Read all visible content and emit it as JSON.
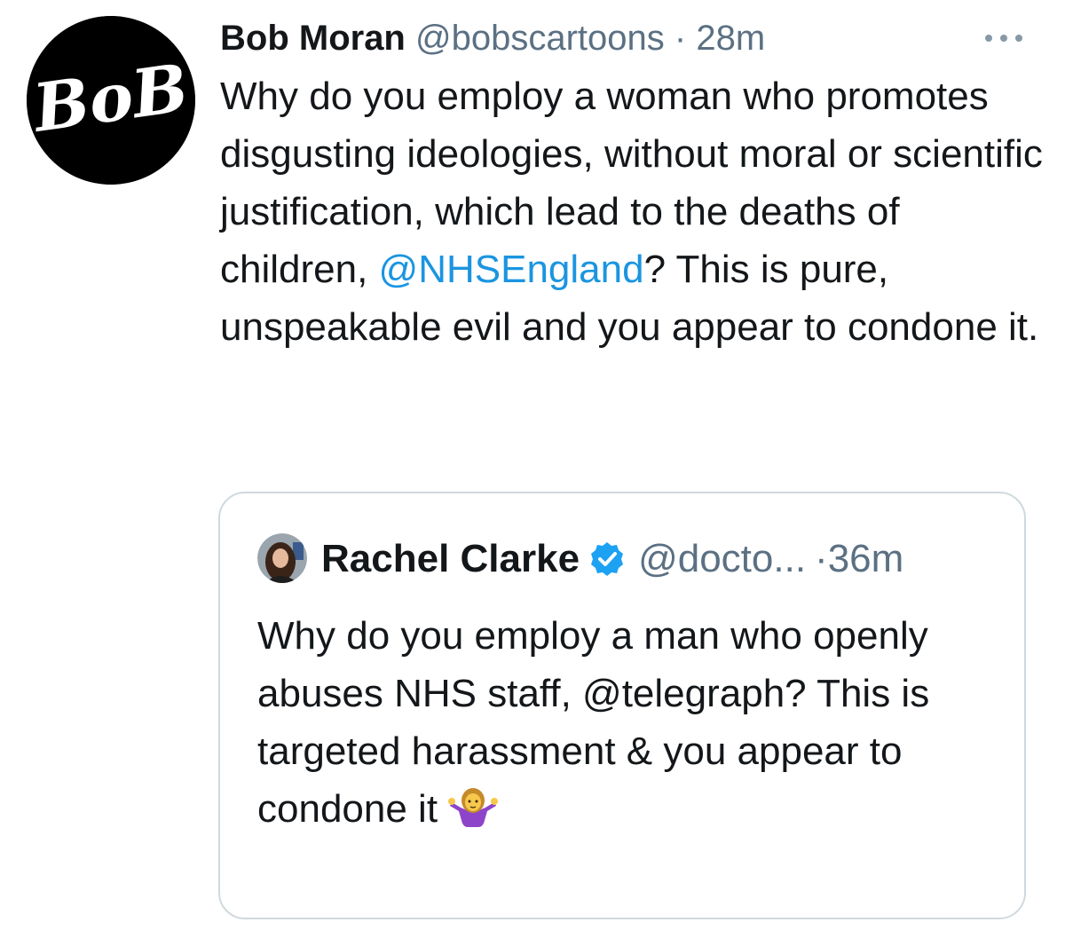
{
  "tweet": {
    "author": {
      "name": "Bob Moran",
      "handle": "@bobscartoons",
      "avatar_text": "BoB"
    },
    "separator": "·",
    "time": "28m",
    "text": {
      "part1": "Why do you employ a woman who promotes disgusting ideologies, without moral or scientific justification, which lead to the deaths of children, ",
      "mention": "@NHSEngland",
      "part2": "? This is pure, unspeakable evil and you appear to condone it."
    },
    "more_icon": "more-horizontal-icon"
  },
  "quote": {
    "author": {
      "name": "Rachel Clarke",
      "handle": "@docto...",
      "verified_icon": "verified-badge-icon"
    },
    "separator": "·",
    "time": "36m",
    "text": "Why do you employ a man who openly abuses NHS staff, @telegraph? This is targeted harassment & you appear to condone it",
    "emoji_icon": "person-shrugging-emoji"
  },
  "colors": {
    "text": "#14171a",
    "muted": "#5b7083",
    "link": "#1b95e0",
    "border": "#cfd9de",
    "verified": "#1da1f2"
  }
}
